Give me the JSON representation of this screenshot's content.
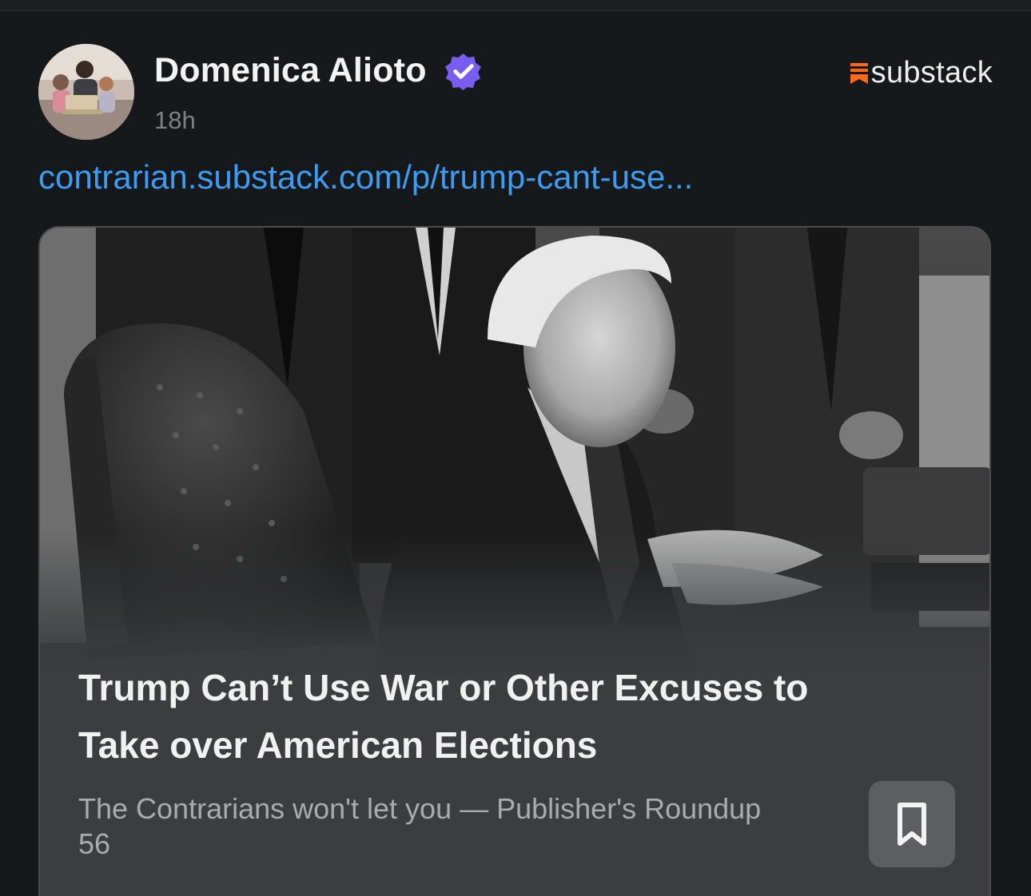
{
  "post": {
    "author_name": "Domenica Alioto",
    "verified": true,
    "timestamp": "18h",
    "brand": "substack",
    "link": "contrarian.substack.com/p/trump-cant-use..."
  },
  "card": {
    "title": "Trump Can’t Use War or Other Excuses to Take over American Elections",
    "subtitle": "The Contrarians won't let you — Publisher's Roundup 56",
    "image_icon": "photo-grayscale-office-scene"
  },
  "colors": {
    "background": "#16191b",
    "link": "#3d9bf0",
    "verified_badge": "#7b5cf0",
    "brand_mark": "#ff6719",
    "card_background": "#3b3d40"
  },
  "icons": {
    "verified": "verified-check-icon",
    "brand": "substack-logo-icon",
    "bookmark": "bookmark-icon"
  }
}
